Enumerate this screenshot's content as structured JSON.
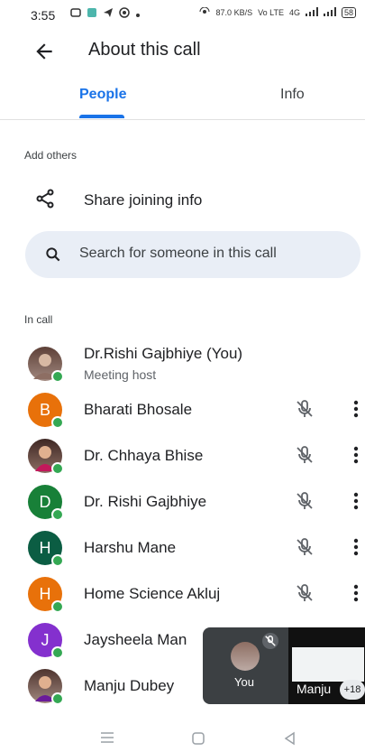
{
  "status_bar": {
    "time": "3:55",
    "speed": "87.0",
    "speed_unit": "KB/S",
    "net": "Vo LTE",
    "signal": "4G",
    "battery": "58"
  },
  "app_bar": {
    "title": "About this call"
  },
  "tabs": [
    {
      "label": "People",
      "active": true
    },
    {
      "label": "Info",
      "active": false
    }
  ],
  "add_others": {
    "section_label": "Add others",
    "share_label": "Share joining info"
  },
  "search": {
    "placeholder": "Search for someone in this call"
  },
  "in_call": {
    "section_label": "In call",
    "participants": [
      {
        "name": "Dr.Rishi Gajbhiye (You)",
        "subtitle": "Meeting host",
        "avatar": "photo",
        "color": "#7b8a6b"
      },
      {
        "name": "Bharati Bhosale",
        "avatar": "letter",
        "letter": "B",
        "color": "#e8710a",
        "muted": true
      },
      {
        "name": "Dr. Chhaya Bhise",
        "avatar": "photo",
        "color": "#6d4c41",
        "muted": true
      },
      {
        "name": "Dr. Rishi Gajbhiye",
        "avatar": "letter",
        "letter": "D",
        "color": "#188038",
        "muted": true
      },
      {
        "name": "Harshu Mane",
        "avatar": "letter",
        "letter": "H",
        "color": "#0b5d43",
        "muted": true
      },
      {
        "name": "Home Science Akluj",
        "avatar": "letter",
        "letter": "H",
        "color": "#e8710a",
        "muted": true
      },
      {
        "name": "Jaysheela Man",
        "avatar": "letter",
        "letter": "J",
        "color": "#8430ce"
      },
      {
        "name": "Manju Dubey",
        "avatar": "photo",
        "color": "#6d4c41"
      }
    ]
  },
  "pip": {
    "self_label": "You",
    "remote_label": "Manju",
    "more_badge": "+18"
  }
}
